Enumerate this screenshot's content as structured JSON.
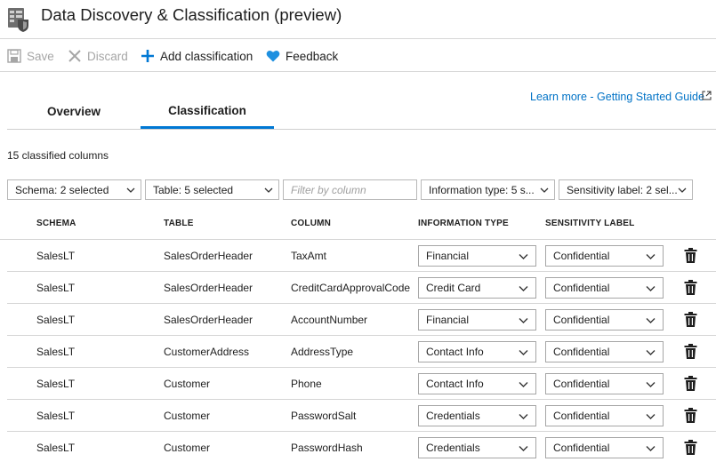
{
  "app": {
    "title": "Data Discovery & Classification (preview)",
    "icon": "database-shield-icon"
  },
  "toolbar": {
    "save_label": "Save",
    "discard_label": "Discard",
    "add_label": "Add classification",
    "feedback_label": "Feedback"
  },
  "links": {
    "learn_more": "Learn more - Getting Started Guide"
  },
  "tabs": [
    {
      "label": "Overview",
      "active": false
    },
    {
      "label": "Classification",
      "active": true
    }
  ],
  "summary": {
    "count_text": "15 classified columns"
  },
  "filters": {
    "schema": "Schema: 2 selected",
    "table": "Table: 5 selected",
    "column_placeholder": "Filter by column",
    "info_type": "Information type: 5 s...",
    "sensitivity": "Sensitivity label: 2 sel..."
  },
  "columns": [
    "SCHEMA",
    "TABLE",
    "COLUMN",
    "INFORMATION TYPE",
    "SENSITIVITY LABEL"
  ],
  "rows": [
    {
      "schema": "SalesLT",
      "table": "SalesOrderHeader",
      "column": "TaxAmt",
      "info_type": "Financial",
      "label": "Confidential"
    },
    {
      "schema": "SalesLT",
      "table": "SalesOrderHeader",
      "column": "CreditCardApprovalCode",
      "info_type": "Credit Card",
      "label": "Confidential"
    },
    {
      "schema": "SalesLT",
      "table": "SalesOrderHeader",
      "column": "AccountNumber",
      "info_type": "Financial",
      "label": "Confidential"
    },
    {
      "schema": "SalesLT",
      "table": "CustomerAddress",
      "column": "AddressType",
      "info_type": "Contact Info",
      "label": "Confidential"
    },
    {
      "schema": "SalesLT",
      "table": "Customer",
      "column": "Phone",
      "info_type": "Contact Info",
      "label": "Confidential"
    },
    {
      "schema": "SalesLT",
      "table": "Customer",
      "column": "PasswordSalt",
      "info_type": "Credentials",
      "label": "Confidential"
    },
    {
      "schema": "SalesLT",
      "table": "Customer",
      "column": "PasswordHash",
      "info_type": "Credentials",
      "label": "Confidential"
    }
  ],
  "colors": {
    "accent": "#0078d4",
    "link": "#0072c6",
    "disabled": "#a6a6a6"
  }
}
